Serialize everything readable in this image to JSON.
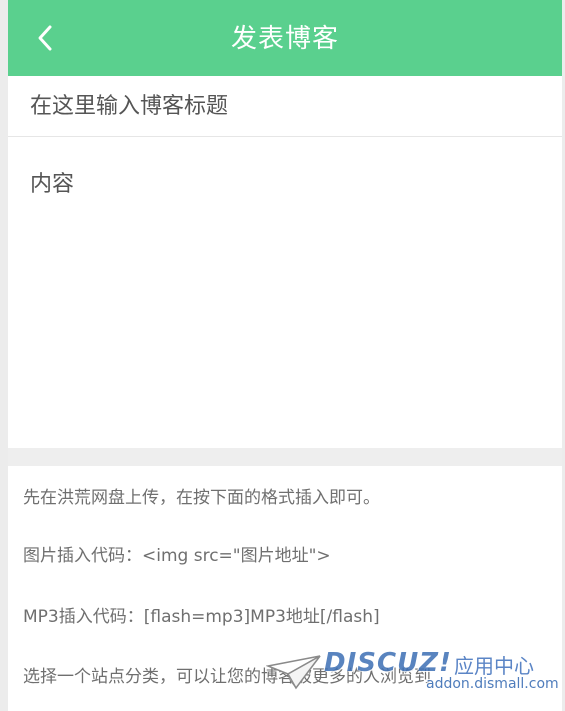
{
  "header": {
    "title": "发表博客",
    "back_icon": "chevron-left-icon",
    "background": "#5ad08e"
  },
  "form": {
    "title_placeholder": "在这里输入博客标题",
    "title_value": "",
    "content_placeholder": "内容",
    "content_value": ""
  },
  "tips": {
    "line1": "先在洪荒网盘上传，在按下面的格式插入即可。",
    "line2": "图片插入代码：<img src=\"图片地址\">",
    "line3": "MP3插入代码：[flash=mp3]MP3地址[/flash]",
    "line4": "选择一个站点分类，可以让您的博客被更多的人浏览到"
  },
  "watermark": {
    "brand": "DISCUZ!",
    "center": "应用中心",
    "url": "addon.dismall.com"
  }
}
